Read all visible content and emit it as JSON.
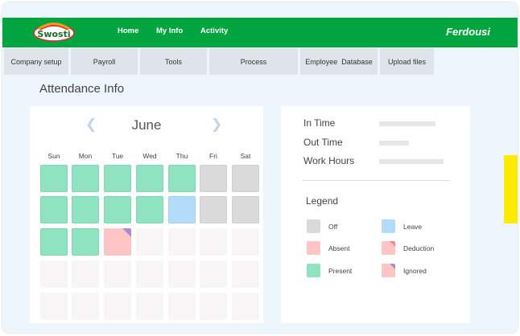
{
  "app": {
    "logo_text": "Swosti",
    "nav": [
      "Home",
      "My Info",
      "Activity"
    ],
    "user": "Ferdousi"
  },
  "tabs": [
    "Company setup",
    "Payroll",
    "Tools",
    "Process",
    "Employee  Database",
    "Upload files"
  ],
  "page_title": "Attendance Info",
  "calendar": {
    "month": "June",
    "prev_icon": "chevron-left-icon",
    "next_icon": "chevron-right-icon",
    "weekdays": [
      "Sun",
      "Mon",
      "Tue",
      "Wed",
      "Thu",
      "Fri",
      "Sat"
    ],
    "weeks": [
      [
        "present",
        "present",
        "present",
        "present",
        "present",
        "off",
        "off"
      ],
      [
        "present",
        "present",
        "present",
        "present",
        "leave",
        "off",
        "off"
      ],
      [
        "present",
        "present",
        "ignored",
        "empty",
        "empty",
        "empty",
        "empty"
      ],
      [
        "empty",
        "empty",
        "empty",
        "empty",
        "empty",
        "empty",
        "empty"
      ],
      [
        "empty",
        "empty",
        "empty",
        "empty",
        "empty",
        "empty",
        "empty"
      ]
    ]
  },
  "info": {
    "fields": [
      "In Time",
      "Out Time",
      "Work Hours"
    ],
    "legend_title": "Legend",
    "legend": [
      {
        "label": "Off",
        "status": "off"
      },
      {
        "label": "Leave",
        "status": "leave"
      },
      {
        "label": "Absent",
        "status": "absent"
      },
      {
        "label": "Deduction",
        "status": "deduction"
      },
      {
        "label": "Present",
        "status": "present"
      },
      {
        "label": "Ignored",
        "status": "ignored"
      }
    ]
  },
  "colors": {
    "brand_green": "#00a540",
    "present": "#8fe3c1",
    "off": "#dadada",
    "leave": "#b3dcf8",
    "absent": "#ffc4c4",
    "deduction": "#ffc4c4",
    "ignored": "#ffc4c4",
    "corner_purple": "#a98bd2",
    "empty": "#f7f5f5",
    "highlight_yellow": "#ffea00"
  }
}
